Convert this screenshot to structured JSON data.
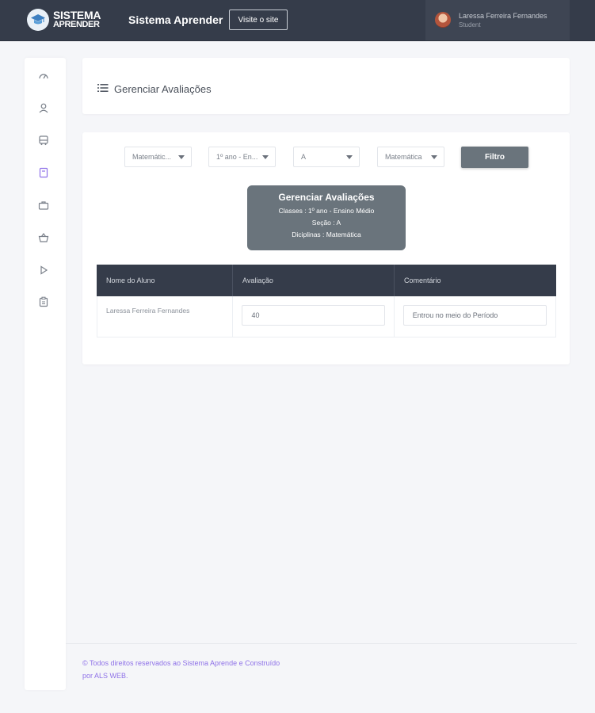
{
  "topbar": {
    "logo_line1": "SISTEMA",
    "logo_line2": "APRENDER",
    "app_title": "Sistema Aprender",
    "visit_button": "Visite o site",
    "user": {
      "name": "Laressa Ferreira Fernandes",
      "role": "Student"
    }
  },
  "sidebar": {
    "items": [
      {
        "icon": "dashboard-gauge-icon",
        "active": false
      },
      {
        "icon": "user-icon",
        "active": false
      },
      {
        "icon": "bus-icon",
        "active": false
      },
      {
        "icon": "book-icon",
        "active": true
      },
      {
        "icon": "briefcase-icon",
        "active": false
      },
      {
        "icon": "basket-icon",
        "active": false
      },
      {
        "icon": "play-icon",
        "active": false
      },
      {
        "icon": "clipboard-icon",
        "active": false
      }
    ]
  },
  "page": {
    "title": "Gerenciar Avaliações"
  },
  "filters": {
    "subject_select": "Matemátic...",
    "class_select": "1º ano - En...",
    "section_select": "A",
    "discipline_select": "Matemática",
    "filter_button": "Filtro"
  },
  "info_box": {
    "title": "Gerenciar Avaliações",
    "classes": "Classes : 1º ano - Ensino Médio",
    "section": "Seção : A",
    "disciplines": "Diciplinas : Matemática"
  },
  "table": {
    "columns": [
      "Nome do Aluno",
      "Avaliação",
      "Comentário"
    ],
    "rows": [
      {
        "student": "Laressa Ferreira Fernandes",
        "grade": "40",
        "comment": "Entrou no meio do Período"
      }
    ]
  },
  "footer": {
    "line1": "© Todos direitos reservados ao Sistema Aprende e Construído",
    "line2": "por ALS WEB."
  },
  "colors": {
    "topbar": "#353c4a",
    "accent_purple": "#8f72e8",
    "info_box": "#6a747c",
    "background": "#f5f6f9"
  }
}
